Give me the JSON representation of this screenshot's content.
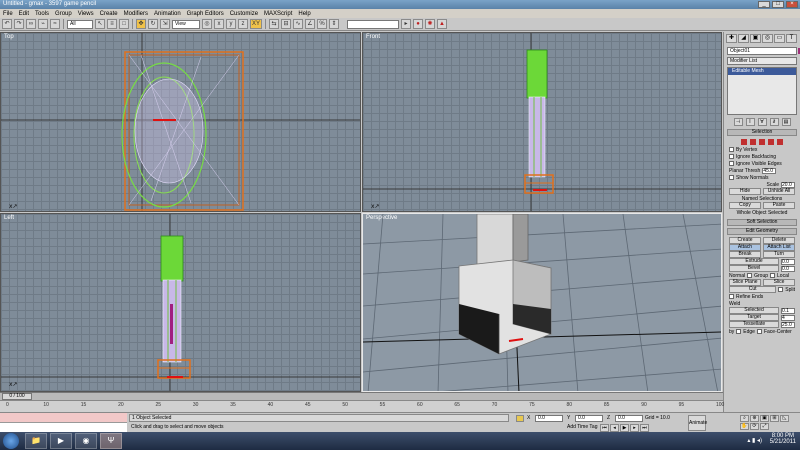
{
  "window": {
    "title": "Untitled - gmax - 3597 game pencil",
    "buttons": [
      "_",
      "□",
      "×"
    ]
  },
  "menu": [
    "File",
    "Edit",
    "Tools",
    "Group",
    "Views",
    "Create",
    "Modifiers",
    "Animation",
    "Graph Editors",
    "Customize",
    "MAXScript",
    "Help"
  ],
  "toolbar": {
    "filter_value": "All",
    "refcoord_value": "View",
    "axis_label": "XY",
    "named_sel_value": ""
  },
  "viewports": {
    "top": "Top",
    "front": "Front",
    "left": "Left",
    "perspective": "Perspective"
  },
  "command_panel": {
    "tabs": [
      "✚",
      "◢",
      "▣",
      "◎",
      "▭",
      "T"
    ],
    "object_name": "Object01",
    "object_color": "#a0307a",
    "modifier_list": "Modifier List",
    "stack_item": "Editable Mesh",
    "stack_buttons": [
      "⊣",
      "I",
      "∀",
      "∂",
      "▤"
    ],
    "selection": {
      "header": "Selection",
      "by_vertex": "By Vertex",
      "ignore_backfacing": "Ignore Backfacing",
      "ignore_visible_edges": "Ignore Visible Edges",
      "planar_thresh_label": "Planar Thresh",
      "planar_thresh_value": "45.0",
      "show_normals": "Show Normals",
      "scale_label": "Scale",
      "scale_value": "20.0",
      "hide": "Hide",
      "unhide_all": "Unhide All",
      "named_selections": "Named Selections",
      "copy": "Copy",
      "paste": "Paste",
      "whole_object": "Whole Object Selected"
    },
    "soft_selection": "Soft Selection",
    "edit_geometry": {
      "header": "Edit Geometry",
      "create": "Create",
      "delete": "Delete",
      "attach": "Attach",
      "attach_list": "Attach List",
      "break": "Break",
      "turn": "Turn",
      "extrude_label": "Extrude",
      "extrude_value": "0.0",
      "bevel_label": "Bevel",
      "bevel_value": "0.0",
      "normal_label": "Normal",
      "group": "Group",
      "local": "Local",
      "slice_plane": "Slice Plane",
      "slice": "Slice",
      "cut": "Cut",
      "split": "Split",
      "refine_ends": "Refine Ends",
      "weld_label": "Weld",
      "selected_label": "Selected",
      "selected_value": "0.1",
      "target_label": "Target",
      "target_value": "4",
      "tessellate": "Tessellate",
      "tessellate_value": "25.0",
      "by_label": "by",
      "edge": "Edge",
      "face_center": "Face-Center"
    }
  },
  "timeline": {
    "slider": "0 / 100",
    "ticks": [
      "0",
      "10",
      "15",
      "20",
      "25",
      "30",
      "35",
      "40",
      "45",
      "50",
      "55",
      "60",
      "65",
      "70",
      "75",
      "80",
      "85",
      "90",
      "95",
      "100"
    ]
  },
  "status": {
    "selection": "1 Object Selected",
    "prompt": "Click and drag to select and move objects",
    "x_label": "X",
    "x_value": "0.0",
    "y_label": "Y",
    "y_value": "0.0",
    "z_label": "Z",
    "z_value": "0.0",
    "grid": "Grid = 10.0",
    "add_time_tag": "Add Time Tag",
    "animate": "Animate"
  },
  "taskbar": {
    "time": "8:00 PM",
    "date": "5/21/2011",
    "apps": [
      "📁",
      "▶",
      "◉",
      "Ψ"
    ]
  }
}
